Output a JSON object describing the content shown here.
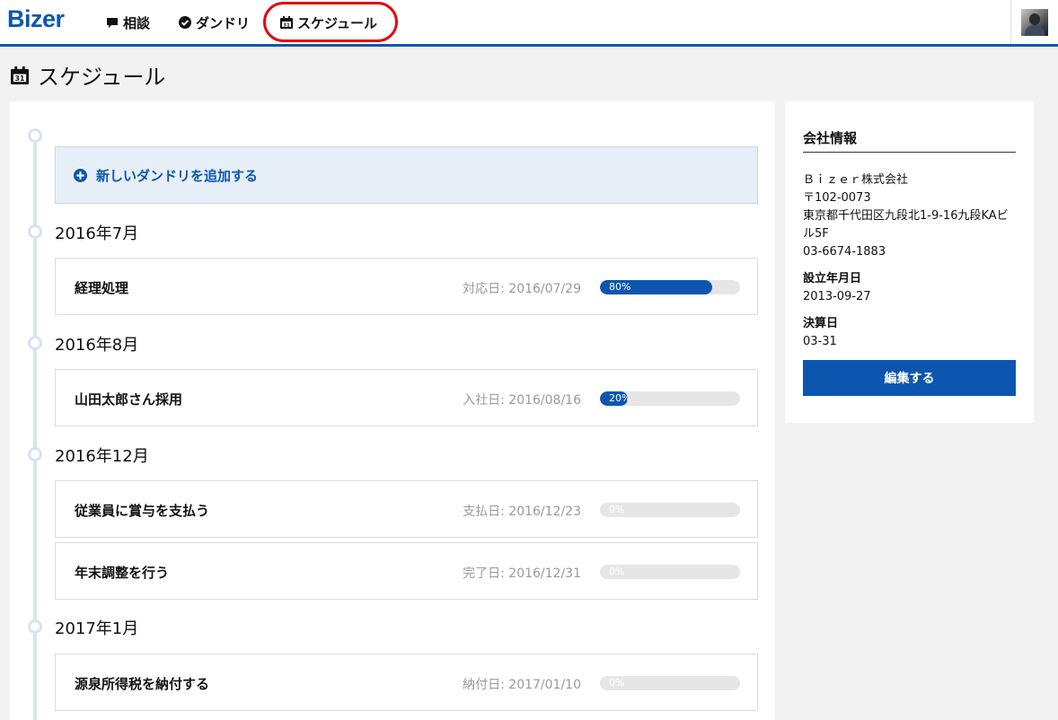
{
  "app": {
    "logo": "Bizer"
  },
  "nav": {
    "consult_label": "相談",
    "dandori_label": "ダンドリ",
    "schedule_label": "スケジュール"
  },
  "page": {
    "title": "スケジュール"
  },
  "icons": {
    "consult": "speech-bubble-icon",
    "dandori": "check-circle-icon",
    "schedule": "calendar-icon",
    "add": "plus-circle-icon"
  },
  "colors": {
    "accent": "#0d56b0",
    "highlight": "#e30613",
    "timeline": "#d6e4ef"
  },
  "timeline": {
    "add_label": "新しいダンドリを追加する",
    "months": [
      {
        "label": "2016年7月",
        "tasks": [
          {
            "name": "経理処理",
            "date": "対応日: 2016/07/29",
            "progress": 80,
            "progress_label": "80%"
          }
        ]
      },
      {
        "label": "2016年8月",
        "tasks": [
          {
            "name": "山田太郎さん採用",
            "date": "入社日: 2016/08/16",
            "progress": 20,
            "progress_label": "20%"
          }
        ]
      },
      {
        "label": "2016年12月",
        "tasks": [
          {
            "name": "従業員に賞与を支払う",
            "date": "支払日: 2016/12/23",
            "progress": 0,
            "progress_label": "0%"
          },
          {
            "name": "年末調整を行う",
            "date": "完了日: 2016/12/31",
            "progress": 0,
            "progress_label": "0%"
          }
        ]
      },
      {
        "label": "2017年1月",
        "tasks": [
          {
            "name": "源泉所得税を納付する",
            "date": "納付日: 2017/01/10",
            "progress": 0,
            "progress_label": "0%"
          }
        ]
      }
    ]
  },
  "company": {
    "title": "会社情報",
    "name": "Ｂｉｚｅｒ株式会社",
    "postal": "〒102-0073",
    "address": "東京都千代田区九段北1-9-16九段KAビル5F",
    "phone": "03-6674-1883",
    "established_label": "設立年月日",
    "established": "2013-09-27",
    "fiscal_label": "決算日",
    "fiscal": "03-31",
    "edit_label": "編集する"
  }
}
